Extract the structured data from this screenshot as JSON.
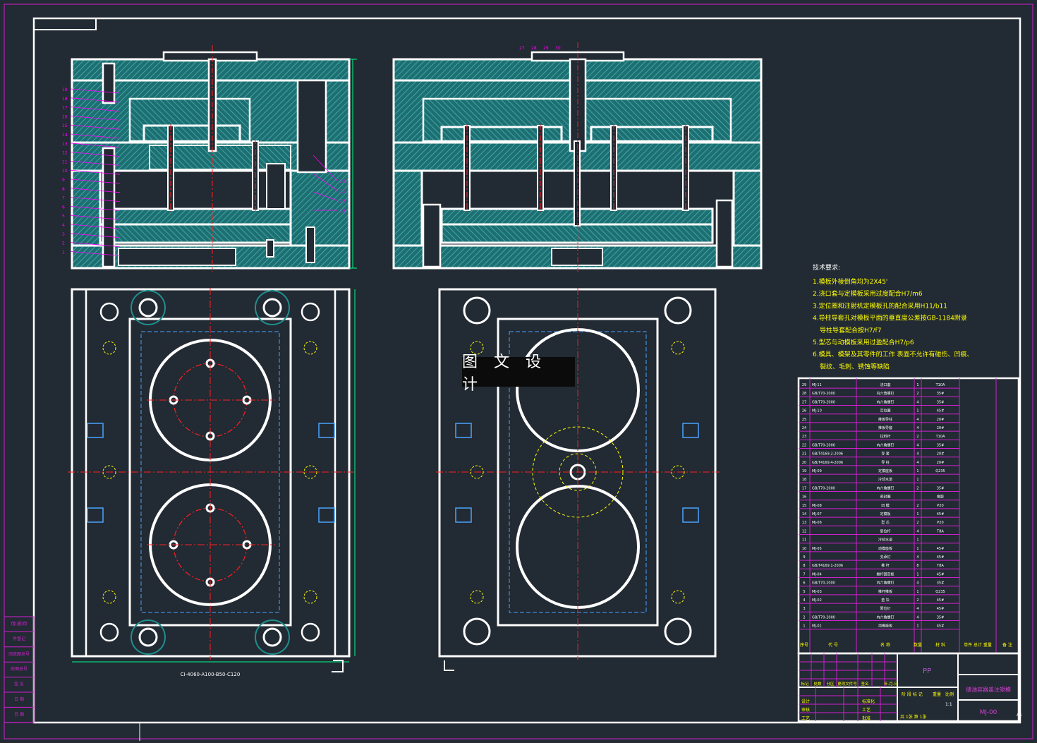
{
  "watermark": "图 文 设 计",
  "tech_notes": {
    "title": "技术要求:",
    "lines": [
      "1.模板外棱倒角均为2X45'",
      "2.浇口套与定模板采用过度配合H7/m6",
      "3.定位圈和注射机定模板孔的配合采用H11/b11",
      "4.导柱导套孔对模板平面的垂直度公差按GB-1184附录",
      "导柱导套配合按H7/f7",
      "5.型芯与动模板采用过盈配合H7/p6",
      "6.模具、模架及其零件的工作 表面不允许有碰伤、凹痕、",
      "裂纹、毛刺、锈蚀等缺陷"
    ]
  },
  "plan_caption": "CI-4060-A100-B50-C120",
  "colors": {
    "bg": "#222a33",
    "line": "#ffffff",
    "hatch": "#1f8f8f",
    "center": "#ff2020",
    "dim": "#00ff88",
    "leader": "#ff00ff",
    "yellow": "#ffff00",
    "cyan": "#00e5ff"
  },
  "left_labels": [
    "19",
    "18",
    "17",
    "16",
    "15",
    "14",
    "13",
    "12",
    "11",
    "10",
    "9",
    "8",
    "7",
    "6",
    "5",
    "4",
    "3",
    "2",
    "1"
  ],
  "right_labels": [
    "20",
    "21",
    "22",
    "23"
  ],
  "top_labels": [
    "27",
    "28",
    "29",
    "30"
  ],
  "bom": {
    "headers": [
      "序号",
      "代 号",
      "名 称",
      "数量",
      "材 料",
      "单件 总计 重量",
      "备 注"
    ],
    "rows": [
      [
        "29",
        "MJ-11",
        "浇口套",
        "1",
        "T10A"
      ],
      [
        "28",
        "GB/T70-2000",
        "内六角螺钉",
        "2",
        "35#"
      ],
      [
        "27",
        "GB/T70-2000",
        "内六角螺钉",
        "4",
        "35#"
      ],
      [
        "26",
        "MJ-10",
        "定位圈",
        "1",
        "45#"
      ],
      [
        "25",
        "",
        "推板导柱",
        "4",
        "20#"
      ],
      [
        "24",
        "",
        "推板导套",
        "4",
        "20#"
      ],
      [
        "23",
        "",
        "拉料杆",
        "2",
        "T10A"
      ],
      [
        "22",
        "GB/T70-2000",
        "内六角螺钉",
        "4",
        "35#"
      ],
      [
        "21",
        "GB/T4169.2-2006",
        "导 套",
        "4",
        "20#"
      ],
      [
        "20",
        "GB/T4169.4-2006",
        "导 柱",
        "4",
        "20#"
      ],
      [
        "19",
        "MJ-09",
        "定模座板",
        "1",
        "Q235"
      ],
      [
        "18",
        "",
        "冷却水道",
        "1",
        ""
      ],
      [
        "17",
        "GB/T70-2000",
        "内六角螺钉",
        "2",
        "35#"
      ],
      [
        "16",
        "",
        "密封圈",
        "",
        "橡胶"
      ],
      [
        "15",
        "MJ-08",
        "凹 模",
        "2",
        "P20"
      ],
      [
        "14",
        "MJ-07",
        "定模板",
        "1",
        "45#"
      ],
      [
        "13",
        "MJ-06",
        "型 芯",
        "2",
        "P20"
      ],
      [
        "12",
        "",
        "复位杆",
        "4",
        "T8A"
      ],
      [
        "11",
        "",
        "冷却水道",
        "1",
        ""
      ],
      [
        "10",
        "MJ-05",
        "动模座板",
        "1",
        "45#"
      ],
      [
        "9",
        "",
        "支承钉",
        "4",
        "45#"
      ],
      [
        "8",
        "GB/T4169.1-2006",
        "推 杆",
        "8",
        "T8A"
      ],
      [
        "7",
        "MJ-04",
        "推杆固定板",
        "1",
        "45#"
      ],
      [
        "6",
        "GB/T70-2000",
        "内六角螺钉",
        "4",
        "35#"
      ],
      [
        "5",
        "MJ-03",
        "推杆推板",
        "1",
        "Q235"
      ],
      [
        "4",
        "MJ-02",
        "垫 块",
        "2",
        "45#"
      ],
      [
        "3",
        "",
        "限位钉",
        "4",
        "45#"
      ],
      [
        "2",
        "GB/T70-2000",
        "内六角螺钉",
        "4",
        "35#"
      ],
      [
        "1",
        "MJ-01",
        "动模座板",
        "1",
        "45#"
      ]
    ]
  },
  "title_block": {
    "material": "PP",
    "drawing_name": "储油容器盖注塑模",
    "drawing_no": "MJ-00",
    "scale": "1:1",
    "sheet_info": "共 1张 第 1张",
    "stage_label": "阶 段 标 记",
    "weight_label": "重量",
    "scale_label": "比例",
    "revision_labels": [
      "标记",
      "处数",
      "分区",
      "更改文件号",
      "签名",
      "年.月.日"
    ],
    "sign_rows": [
      [
        "设计",
        "",
        "标准化"
      ],
      [
        "审核",
        "",
        "工艺"
      ],
      [
        "工艺",
        "",
        "批准"
      ]
    ]
  },
  "side_stamp": [
    "借(通)用",
    "件登记",
    "旧底图总号",
    "底图总号",
    "签 名",
    "日 期",
    "日 期"
  ],
  "sheet_mark": "A1"
}
